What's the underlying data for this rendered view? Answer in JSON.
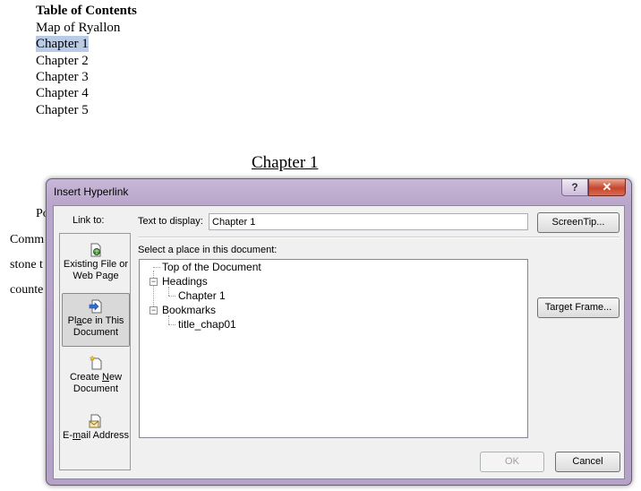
{
  "document": {
    "toc_title": "Table of Contents",
    "toc_items": [
      "Map of Ryallon",
      "Chapter 1",
      "Chapter 2",
      "Chapter 3",
      "Chapter 4",
      "Chapter 5"
    ],
    "chapter_heading": "Chapter 1",
    "body_fragments": [
      "Po",
      "Comm",
      "stone t",
      "counte"
    ]
  },
  "dialog": {
    "title": "Insert Hyperlink",
    "help_label": "?",
    "close_label": "✕",
    "link_to_label": "Link to:",
    "link_options": [
      {
        "pre": "",
        "ul": "",
        "post": "Existing File or",
        "line2": "Web Page",
        "icon": "existing-file-icon"
      },
      {
        "pre": "Pl",
        "ul": "a",
        "post": "ce in This",
        "line2": "Document",
        "icon": "place-in-document-icon"
      },
      {
        "pre": "Create ",
        "ul": "N",
        "post": "ew",
        "line2": "Document",
        "icon": "new-document-icon"
      },
      {
        "pre": "E-",
        "ul": "m",
        "post": "ail Address",
        "line2": "",
        "icon": "email-address-icon"
      }
    ],
    "text_to_display_label": "Text to display:",
    "text_to_display_value": "Chapter 1",
    "screentip_label": "ScreenTip...",
    "place_label": "Select a place in this document:",
    "tree": {
      "top": "Top of the Document",
      "headings": "Headings",
      "heading_items": [
        "Chapter 1"
      ],
      "bookmarks": "Bookmarks",
      "bookmark_items": [
        "title_chap01"
      ],
      "expander": "−"
    },
    "target_frame_label": "Target Frame...",
    "ok_label": "OK",
    "cancel_label": "Cancel"
  }
}
